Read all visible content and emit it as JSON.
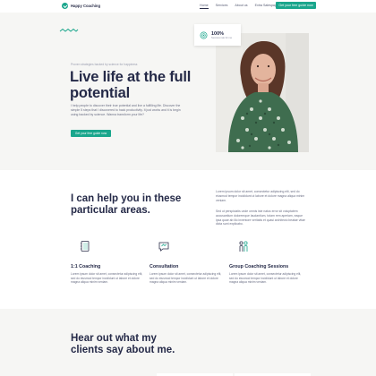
{
  "header": {
    "brand": "Happy Coaching",
    "nav": [
      "Home",
      "Services",
      "About us",
      "Extra Salespage"
    ],
    "cta": "Get your free guide now"
  },
  "hero": {
    "eyebrow": "Proven strategies backed by science for happiness",
    "title": "Live life at the full potential",
    "description": "I help people to discover their true potential and live a fulfilling life. Discover the simple 5 steps that I discovered to hack productivity. It just works and it is begin using backed by science. Wanna transform your life?",
    "cta": "Get your free guide now",
    "stat": {
      "value": "100%",
      "label": "Success rate for me"
    }
  },
  "services": {
    "title": "I can help you in these particular areas.",
    "paragraph1": "Lorem ipsum dolor sit amet, consectetur adipiscing elit, sed do eiusmod tempor incididunt ut labore et dolore magna aliqua minim veniam.",
    "paragraph2": "Sed ut perspiciatis unde omnis iste natus error sit voluptatem accusantium doloremque laudantium, totam rem aperiam, eaque ipsa quae ab illo inventore veritatis et quasi architecto beatae vitae dicta sunt explicabo.",
    "items": [
      {
        "title": "1:1 Coaching",
        "text": "Lorem ipsum dolor sit amet, consectetur adipiscing elit, sed do eiusmod tempor incididunt ut labore et dolore magna aliqua minim veniam.",
        "icon": "notebook-icon"
      },
      {
        "title": "Consultation",
        "text": "Lorem ipsum dolor sit amet, consectetur adipiscing elit, sed do eiusmod tempor incididunt ut labore et dolore magna aliqua minim veniam.",
        "icon": "chat-bubble-icon"
      },
      {
        "title": "Group Coaching Sessions",
        "text": "Lorem ipsum dolor sit amet, consectetur adipiscing elit, sed do eiusmod tempor incididunt ut labore et dolore magna aliqua minim veniam.",
        "icon": "group-people-icon"
      }
    ]
  },
  "testimonials": {
    "title": "Hear out what my clients say about me."
  },
  "colors": {
    "accent": "#1aa68c",
    "heading": "#252a48",
    "hero_bg": "#f6f6f4"
  }
}
